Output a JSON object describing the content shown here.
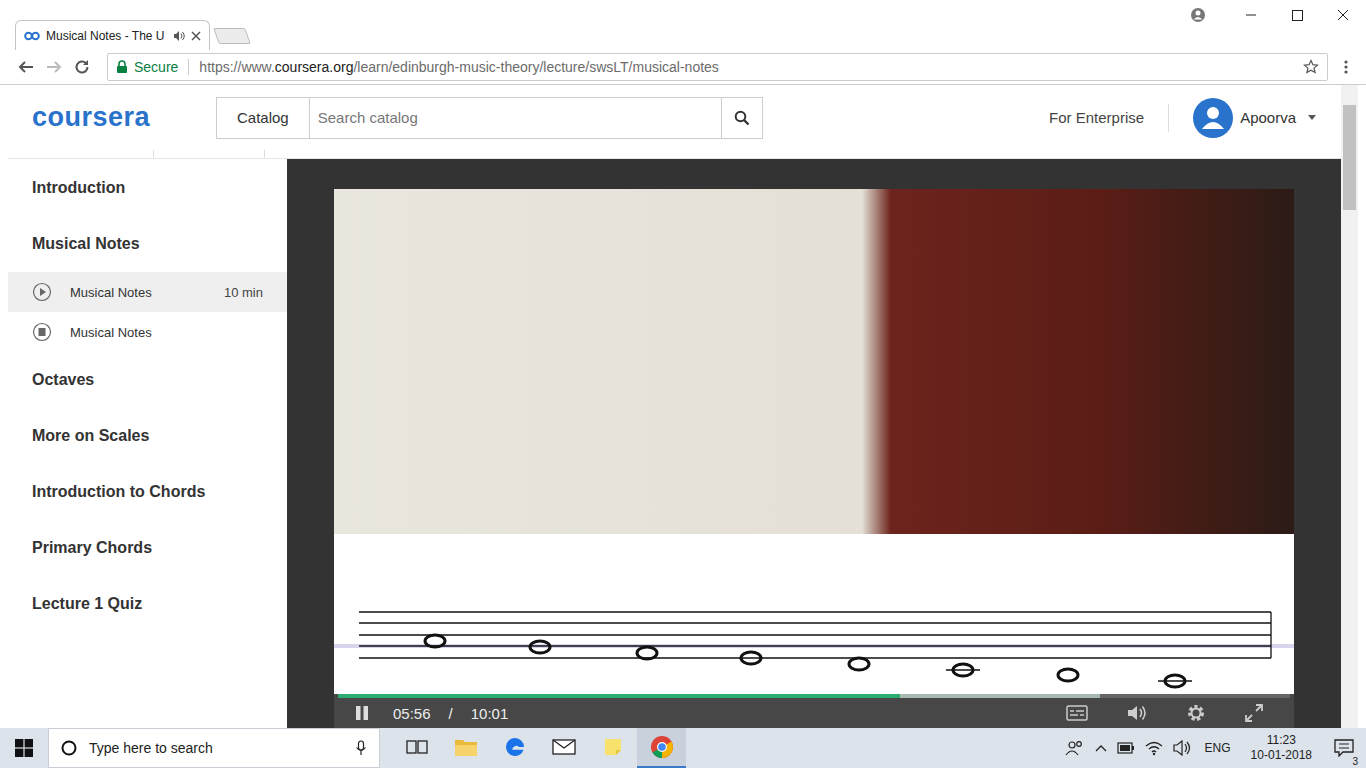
{
  "browser": {
    "tab": {
      "title": "Musical Notes - The U",
      "audio_playing": true,
      "selected": true
    },
    "address_bar": {
      "secure_label": "Secure",
      "url_scheme": "https://www.",
      "url_domain": "coursera.org",
      "url_path": "/learn/edinburgh-music-theory/lecture/swsLT/musical-notes",
      "bookmarked": false
    }
  },
  "header": {
    "logo": "coursera",
    "catalog_button": "Catalog",
    "search_placeholder": "Search catalog",
    "enterprise_link": "For Enterprise",
    "user_name": "Apoorva"
  },
  "sidebar": {
    "sections": [
      {
        "title": "Introduction",
        "items": []
      },
      {
        "title": "Musical Notes",
        "items": [
          {
            "kind": "video",
            "label": "Musical Notes",
            "duration": "10 min",
            "selected": true
          },
          {
            "kind": "reading",
            "label": "Musical Notes",
            "selected": false
          }
        ]
      },
      {
        "title": "Octaves",
        "items": []
      },
      {
        "title": "More on Scales",
        "items": []
      },
      {
        "title": "Introduction to Chords",
        "items": []
      },
      {
        "title": "Primary Chords",
        "items": []
      },
      {
        "title": "Lecture 1 Quiz",
        "items": []
      }
    ]
  },
  "player": {
    "playing": true,
    "elapsed": "05:56",
    "separator": "/",
    "total": "10:01",
    "level": 0.59,
    "buffered_level": 0.8
  },
  "taskbar": {
    "search_placeholder": "Type here to search",
    "apps": [
      {
        "kind": "task-view",
        "active": false
      },
      {
        "kind": "explorer",
        "active": false
      },
      {
        "kind": "edge",
        "active": false
      },
      {
        "kind": "mail",
        "active": false
      },
      {
        "kind": "sticky-notes",
        "active": false
      },
      {
        "kind": "chrome",
        "active": true
      }
    ],
    "language": "ENG",
    "time": "11:23",
    "date": "10-01-2018",
    "notifications": "3"
  }
}
